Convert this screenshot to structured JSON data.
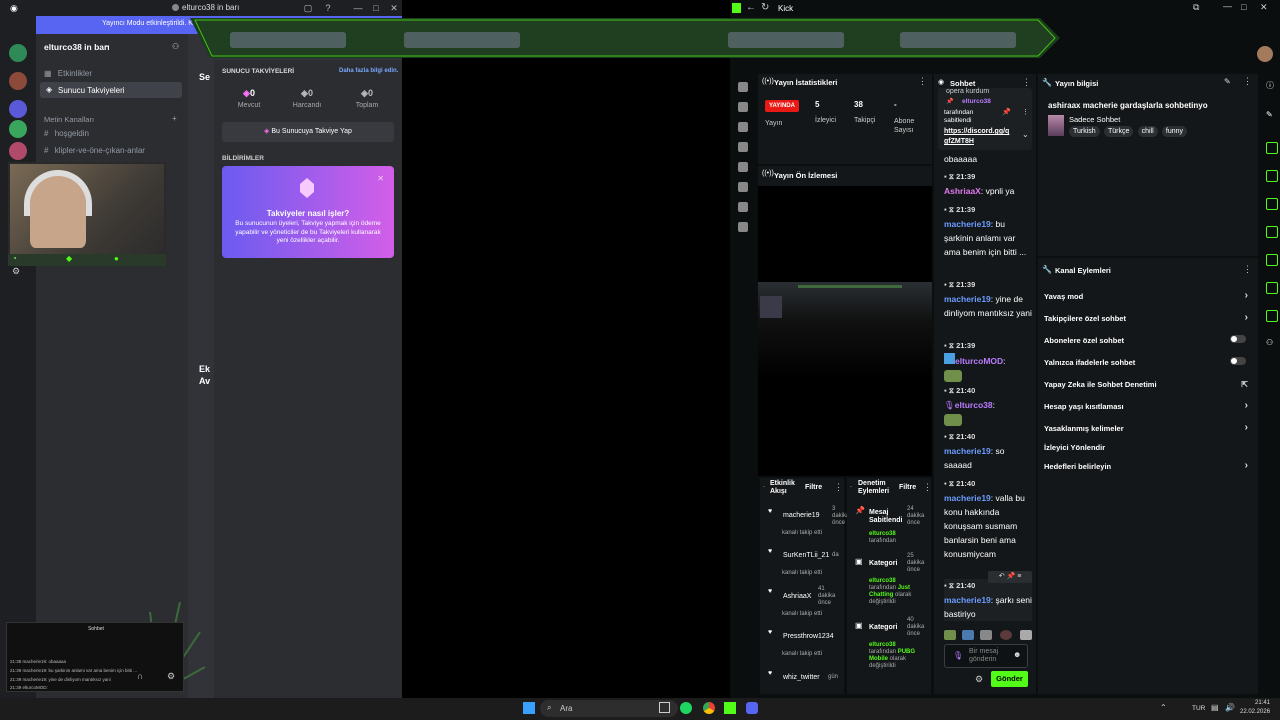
{
  "discord": {
    "window_title": "elturco38 in barı",
    "banner_text": "Yayıncı Modu etkinleştirildi. Kul",
    "server_name": "elturco38 in barı",
    "channels_nav": {
      "events": "Etkinlikler",
      "boosts": "Sunucu Takviyeleri",
      "category": "Metin Kanalları",
      "channel_1": "hoşgeldin",
      "channel_2": "klipler-ve-öne-çıkan-anlar"
    },
    "main_partial": {
      "heading_1": "Se",
      "heading_2": "Ek",
      "heading_2b": "Av"
    },
    "boost_panel": {
      "title": "SUNUCU TAKVİYELERİ",
      "learn_more": "Daha fazla bilgi edin.",
      "stats": [
        {
          "value": "0",
          "label": "Mevcut"
        },
        {
          "value": "0",
          "label": "Harcandı"
        },
        {
          "value": "0",
          "label": "Toplam"
        }
      ],
      "boost_button": "Bu Sunucuya Takviye Yap",
      "notifications_label": "BİLDİRİMLER",
      "card_title": "Takviyeler nasıl işler?",
      "card_body": "Bu sunucunun üyeleri, Takviye yapmak için ödeme yapabilir ve yöneticiler de bu Takviyeleri kullanarak yeni özellikler açabilir."
    },
    "mini_chat": {
      "title": "Sohbet",
      "lines": [
        "21:38 macherie19: obaaaaa",
        "21:39 macherie19: bu şarkinin anlami var ama benim için bitti ...",
        "21:39 macherie19: yine de dinliyom mantıksız yani",
        "21:39 elturcoMOD:"
      ]
    }
  },
  "kick": {
    "window_title": "Kick",
    "stats": {
      "title": "Yayın İstatistikleri",
      "live_badge": "YAYINDA",
      "live_label": "Yayın",
      "viewers_value": "5",
      "viewers_label": "İzleyici",
      "followers_value": "38",
      "followers_label": "Takipçi",
      "subs_value": "-",
      "subs_label": "Abone Sayısı"
    },
    "preview": {
      "title": "Yayın Ön İzlemesi"
    },
    "activity": {
      "title": "Etkinlik Akışı",
      "filter": "Filtre",
      "items": [
        {
          "name": "macherie19",
          "time": "3 dakika önce",
          "sub": "kanalı takip etti"
        },
        {
          "name": "SurKenTLii_21",
          "time": "da",
          "sub": "kanalı takip etti"
        },
        {
          "name": "AshriaaX",
          "time": "41 dakika önce",
          "sub": "kanalı takip etti"
        },
        {
          "name": "Pressthrow1234",
          "time": "",
          "sub": "kanalı takip etti"
        },
        {
          "name": "whiz_twitter",
          "time": "gün",
          "sub": ""
        }
      ]
    },
    "moderation": {
      "title": "Denetim Eylemleri",
      "filter": "Filtre",
      "items": [
        {
          "title": "Mesaj Sabitlendi",
          "time": "24 dakika önce",
          "actor": "elturco38",
          "detail": "tarafından",
          "highlight": ""
        },
        {
          "title": "Kategori",
          "time": "25 dakika önce",
          "actor": "elturco38",
          "detail": "tarafından",
          "highlight": "Just Chatting",
          "tail": "olarak değiştirildi"
        },
        {
          "title": "Kategori",
          "time": "40 dakika önce",
          "actor": "elturco38",
          "detail": "tarafından",
          "highlight": "PUBG Mobile",
          "tail": "olarak değiştirildi"
        }
      ]
    },
    "chat": {
      "title": "Sohbet",
      "pinned_top": "opera kurdum",
      "pinned_by": "elturco38",
      "pinned_label": "tarafından sabitlendi",
      "pinned_link": "https://discord.gg/q gfZMT8H",
      "messages": [
        {
          "time": "",
          "user": "",
          "text": "obaaaaa"
        },
        {
          "time": "21:39",
          "user": "AshriaaX",
          "text": "vpnli ya"
        },
        {
          "time": "21:39",
          "user": "macherie19",
          "text": "bu şarkinin anlamı var ama benim için bitti ..."
        },
        {
          "time": "21:39",
          "user": "macherie19",
          "text": "yine de dinliyom mantıksız yani"
        },
        {
          "time": "21:39",
          "user": "elturcoMOD",
          "text": ""
        },
        {
          "time": "21:40",
          "user": "elturco38",
          "text": ""
        },
        {
          "time": "21:40",
          "user": "macherie19",
          "text": "so saaaad"
        },
        {
          "time": "21:40",
          "user": "macherie19",
          "text": "valla bu konu hakkında konuşsam susmam banlarsin beni ama konusmiycam"
        },
        {
          "time": "21:40",
          "user": "macherie19",
          "text": "şarkı seni bastiriyo"
        }
      ],
      "input_placeholder": "Bir mesaj gönderin",
      "send_button": "Gönder"
    },
    "info": {
      "title": "Yayın bilgisi",
      "stream_title": "ashiraax macherie gardaşlarla sohbetinyo",
      "category": "Sadece Sohbet",
      "tags": [
        "Turkish",
        "Türkçe",
        "chill",
        "funny"
      ]
    },
    "actions": {
      "title": "Kanal Eylemleri",
      "rows": [
        {
          "label": "Yavaş mod",
          "control": "arrow"
        },
        {
          "label": "Takipçilere özel sohbet",
          "control": "arrow"
        },
        {
          "label": "Abonelere özel sohbet",
          "control": "toggle"
        },
        {
          "label": "Yalnızca ifadelerle sohbet",
          "control": "toggle"
        },
        {
          "label": "Yapay Zeka ile Sohbet Denetimi",
          "control": "external"
        },
        {
          "label": "Hesap yaşı kısıtlaması",
          "control": "arrow"
        },
        {
          "label": "Yasaklanmış kelimeler",
          "control": "arrow"
        },
        {
          "label": "İzleyici Yönlendir",
          "control": "none"
        },
        {
          "label": "Hedefleri belirleyin",
          "control": "arrow"
        }
      ]
    }
  },
  "taskbar": {
    "search_placeholder": "Ara",
    "lang": "TUR",
    "time": "21:41",
    "date": "22.02.2026"
  },
  "colors": {
    "kick_green": "#53fc18",
    "discord_blurple": "#5865f2",
    "live_red": "#e91916"
  }
}
